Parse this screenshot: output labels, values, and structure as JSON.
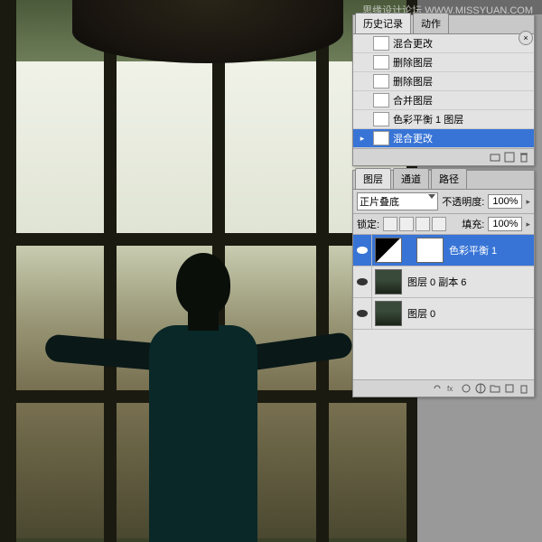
{
  "watermark": "思缘设计论坛   WWW.MISSYUAN.COM",
  "history": {
    "tabs": [
      "历史记录",
      "动作"
    ],
    "items": [
      {
        "label": "混合更改"
      },
      {
        "label": "删除图层"
      },
      {
        "label": "删除图层"
      },
      {
        "label": "合并图层"
      },
      {
        "label": "色彩平衡 1 图层"
      },
      {
        "label": "混合更改"
      }
    ]
  },
  "layers": {
    "tabs": [
      "图层",
      "通道",
      "路径"
    ],
    "blend_mode": "正片叠底",
    "opacity_label": "不透明度:",
    "opacity_value": "100%",
    "lock_label": "锁定:",
    "fill_label": "填充:",
    "fill_value": "100%",
    "items": [
      {
        "name": "色彩平衡 1",
        "type": "adj"
      },
      {
        "name": "图层 0 副本 6",
        "type": "img"
      },
      {
        "name": "图层 0",
        "type": "img"
      }
    ]
  }
}
